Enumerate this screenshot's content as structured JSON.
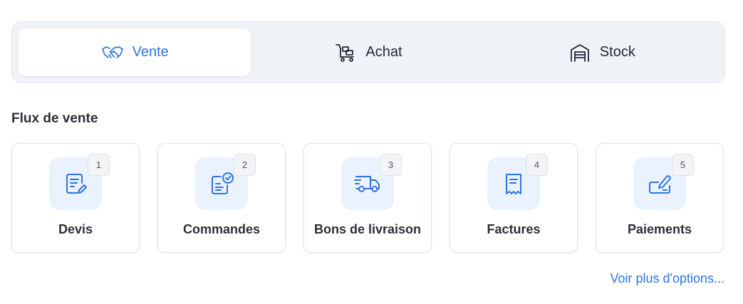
{
  "tabs": [
    {
      "label": "Vente",
      "icon": "handshake-icon",
      "active": true
    },
    {
      "label": "Achat",
      "icon": "cart-icon",
      "active": false
    },
    {
      "label": "Stock",
      "icon": "warehouse-icon",
      "active": false
    }
  ],
  "section": {
    "title": "Flux de vente"
  },
  "cards": [
    {
      "label": "Devis",
      "badge": "1",
      "icon": "document-edit-icon"
    },
    {
      "label": "Commandes",
      "badge": "2",
      "icon": "order-check-icon"
    },
    {
      "label": "Bons de livraison",
      "badge": "3",
      "icon": "delivery-truck-icon"
    },
    {
      "label": "Factures",
      "badge": "4",
      "icon": "receipt-icon"
    },
    {
      "label": "Paiements",
      "badge": "5",
      "icon": "signature-icon"
    }
  ],
  "more_link": "Voir plus d'options...",
  "colors": {
    "accent": "#2f74e0",
    "icon_bg": "#eaf2fe",
    "tabs_bg": "#eff2f6"
  }
}
